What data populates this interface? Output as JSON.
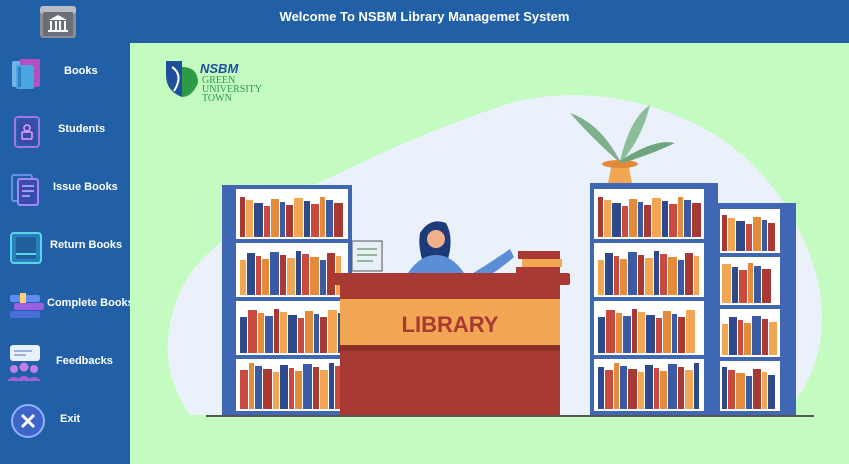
{
  "app": {
    "title": "Welcome To NSBM Library Managemet System",
    "logo_icon": "library-building-icon"
  },
  "sidebar": {
    "items": [
      {
        "label": "Books",
        "icon": "books-icon"
      },
      {
        "label": "Students",
        "icon": "student-book-icon"
      },
      {
        "label": "Issue Books",
        "icon": "issue-books-icon"
      },
      {
        "label": "Return Books",
        "icon": "return-book-icon"
      },
      {
        "label": "Complete Books",
        "icon": "stacked-books-icon"
      },
      {
        "label": "Feedbacks",
        "icon": "feedback-users-icon"
      },
      {
        "label": "Exit",
        "icon": "close-circle-icon"
      }
    ]
  },
  "main": {
    "brand": {
      "name": "NSBM",
      "line1": "GREEN",
      "line2": "UNIVERSITY",
      "line3": "TOWN"
    },
    "illustration": {
      "desk_sign": "LIBRARY"
    }
  },
  "colors": {
    "header_bg": "#2160a6",
    "main_bg": "#c3fbc0",
    "shelf_blue": "#3f67b3",
    "desk_red": "#a83a33",
    "desk_orange": "#f2a552"
  }
}
